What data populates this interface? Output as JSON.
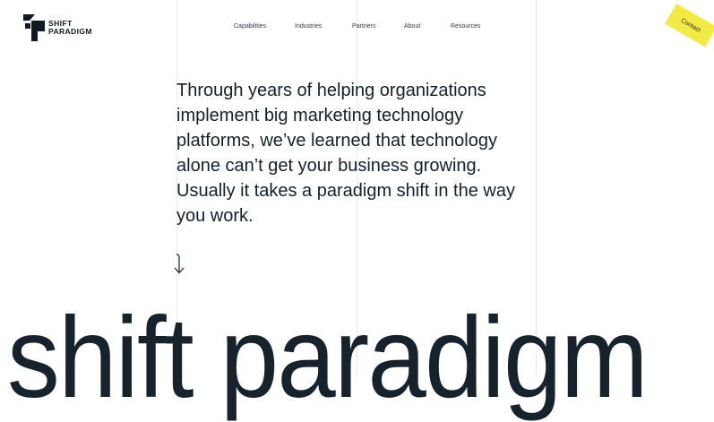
{
  "brand": {
    "line1": "SHIFT",
    "line2": "PARADIGM"
  },
  "nav": {
    "items": [
      {
        "label": "Capabilities"
      },
      {
        "label": "Industries"
      },
      {
        "label": "Partners"
      },
      {
        "label": "About"
      },
      {
        "label": "Resources"
      }
    ]
  },
  "contact": {
    "label": "Contact",
    "color": "#f2ea45"
  },
  "intro": {
    "lines": [
      "Through years of helping organizations",
      "implement big marketing technology",
      "platforms, we’ve learned that technology",
      "alone can’t get your business growing.",
      "Usually it takes a paradigm shift in the way",
      "you work."
    ]
  },
  "scroll": {
    "icon": "down-arrow-icon"
  },
  "hero": {
    "wordmark": "shift paradigm"
  }
}
